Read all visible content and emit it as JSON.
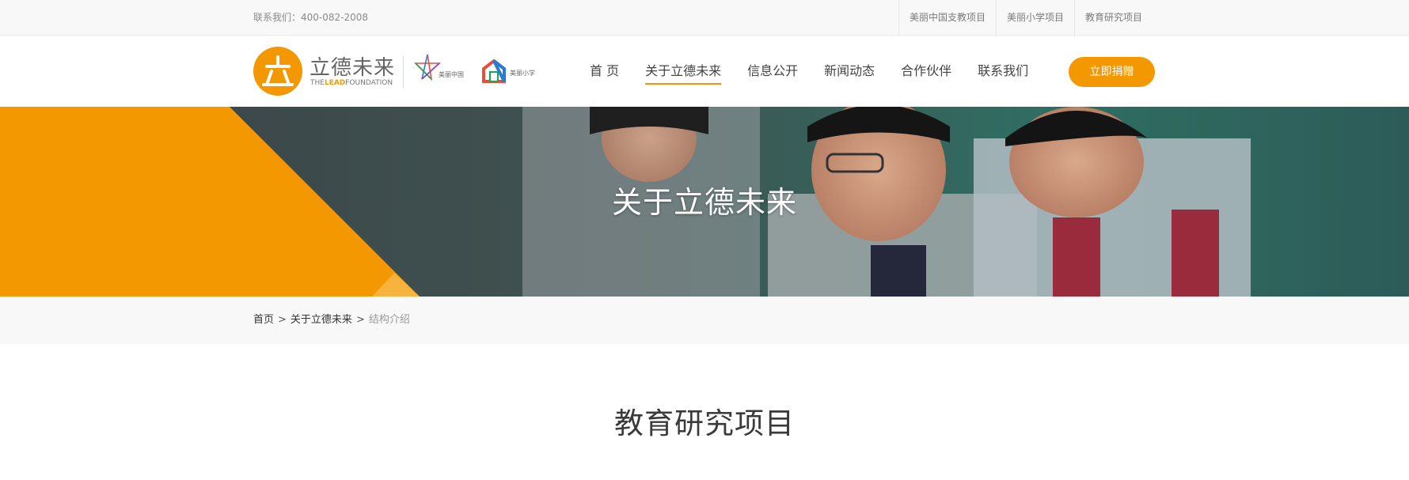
{
  "topbar": {
    "contact": "联系我们：400-082-2008",
    "links": [
      "美丽中国支教项目",
      "美丽小学项目",
      "教育研究项目"
    ]
  },
  "header": {
    "logo_title": "立德未来",
    "logo_sub_pre": "THE",
    "logo_sub_hl": "LEAD",
    "logo_sub_post": "FOUNDATION",
    "partner1": "美丽中国",
    "partner2": "美丽小学",
    "nav": [
      "首 页",
      "关于立德未来",
      "信息公开",
      "新闻动态",
      "合作伙伴",
      "联系我们"
    ],
    "active_nav": "关于立德未来",
    "donate": "立即捐赠",
    "accent_color": "#f39800"
  },
  "banner": {
    "title": "关于立德未来"
  },
  "breadcrumb": {
    "home": "首页",
    "sep": ">",
    "parent": "关于立德未来",
    "current": "结构介绍"
  },
  "page": {
    "title": "教育研究项目"
  }
}
